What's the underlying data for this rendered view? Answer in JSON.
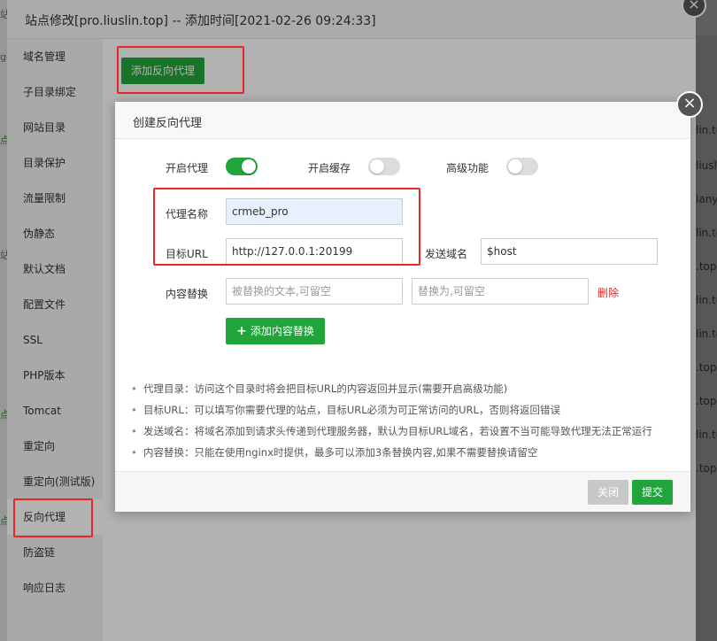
{
  "outer": {
    "title": "站点修改[pro.liuslin.top] -- 添加时间[2021-02-26 09:24:33]",
    "add_proxy_label": "添加反向代理",
    "close_glyph": "×"
  },
  "sidebar": {
    "items": [
      {
        "label": "域名管理"
      },
      {
        "label": "子目录绑定"
      },
      {
        "label": "网站目录"
      },
      {
        "label": "目录保护"
      },
      {
        "label": "流量限制"
      },
      {
        "label": "伪静态"
      },
      {
        "label": "默认文档"
      },
      {
        "label": "配置文件"
      },
      {
        "label": "SSL"
      },
      {
        "label": "PHP版本"
      },
      {
        "label": "Tomcat"
      },
      {
        "label": "重定向"
      },
      {
        "label": "重定向(测试版)"
      },
      {
        "label": "反向代理"
      },
      {
        "label": "防盗链"
      },
      {
        "label": "响应日志"
      }
    ],
    "active_index": 13
  },
  "background": {
    "right_fragments": [
      "lin.top",
      "liuslin",
      "ianyu",
      "lin.top",
      ".top",
      "lin.top",
      "lin.top",
      ".top",
      ".top",
      "lin.top",
      ".top"
    ],
    "left_fragments": [
      "站",
      "ge",
      "点",
      "站",
      "点",
      "点"
    ]
  },
  "modal": {
    "title": "创建反向代理",
    "close_glyph": "×",
    "toggles": {
      "proxy_label": "开启代理",
      "proxy_on": true,
      "cache_label": "开启缓存",
      "cache_on": false,
      "advanced_label": "高级功能",
      "advanced_on": false
    },
    "proxy_name": {
      "label": "代理名称",
      "value": "crmeb_pro"
    },
    "target_url": {
      "label": "目标URL",
      "value": "http://127.0.0.1:20199"
    },
    "send_domain": {
      "label": "发送域名",
      "value": "$host"
    },
    "content_replace": {
      "label": "内容替换",
      "from_placeholder": "被替换的文本,可留空",
      "to_placeholder": "替换为,可留空",
      "delete_label": "删除"
    },
    "add_replace_label": "添加内容替换",
    "add_replace_icon": "+",
    "notes": [
      "代理目录：访问这个目录时将会把目标URL的内容返回并显示(需要开启高级功能)",
      "目标URL：可以填写你需要代理的站点，目标URL必须为可正常访问的URL，否则将返回错误",
      "发送域名：将域名添加到请求头传递到代理服务器，默认为目标URL域名，若设置不当可能导致代理无法正常运行",
      "内容替换：只能在使用nginx时提供，最多可以添加3条替换内容,如果不需要替换请留空"
    ],
    "footer": {
      "close_label": "关闭",
      "submit_label": "提交"
    }
  }
}
